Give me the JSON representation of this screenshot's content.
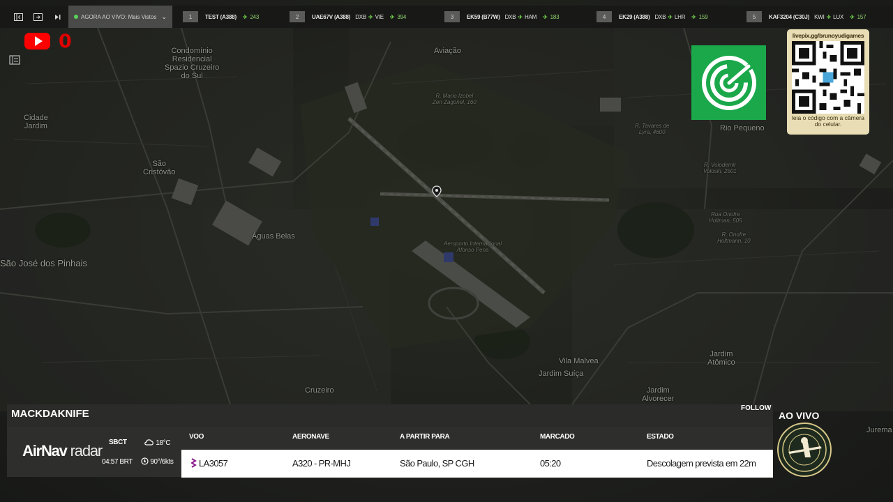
{
  "colors": {
    "live_dot": "#5ad15a",
    "ticker_accent": "#6fce4a",
    "youtube_red": "#ff0000",
    "flightradar_green": "#1aa84a",
    "qr_bg": "#e8ddb4",
    "airline_purple": "#8a1a8c"
  },
  "topbar": {
    "controls": [
      "sidebar-toggle-icon",
      "expand-icon",
      "skip-icon"
    ],
    "live_select": "AGORA AO VIVO: Mais Vistos",
    "flights": [
      {
        "rank": "1",
        "flight": "TEST (A388)",
        "route": "",
        "dest": "",
        "count": "243"
      },
      {
        "rank": "2",
        "flight": "UAE67V (A388)",
        "route": "DXB",
        "dest": "VIE",
        "count": "394"
      },
      {
        "rank": "3",
        "flight": "EK59 (B77W)",
        "route": "DXB",
        "dest": "HAM",
        "count": "183"
      },
      {
        "rank": "4",
        "flight": "EK29 (A388)",
        "route": "DXB",
        "dest": "LHR",
        "count": "159"
      },
      {
        "rank": "5",
        "flight": "KAF3204 (C30J)",
        "route": "KWI",
        "dest": "LUX",
        "count": "157"
      }
    ]
  },
  "overlay": {
    "youtube_count": "0",
    "qr_url": "livepix.gg/brunoyudigames",
    "qr_hint": "leia o código com a câmera do celular."
  },
  "map": {
    "labels": {
      "aviacao": "Aviação",
      "condominio": "Condomínio\nResidencial\nSpazio Cruzeiro\ndo Sul",
      "cidade_jardim": "Cidade\nJardim",
      "sao_cristovao": "São\nCristóvão",
      "sao_jose": "São José dos Pinhais",
      "aguas_belas": "Águas Belas",
      "rio_pequeno": "Rio Pequeno",
      "vila_malvea": "Vila Malvea",
      "jardim_suica": "Jardim Suíça",
      "jardim_alvorecer": "Jardim\nAlvorecer",
      "jardim_atomico": "Jardim\nAtômico",
      "cruzeiro": "Cruzeiro",
      "jurema": "Jurema",
      "aeroporto": "Aeroporto Internacional\nAfonso Pena",
      "r_mario": "R. Mario Izobel\nZen Zagonel, 160",
      "r_tavares": "R. Tavares de\nLyra, 4600",
      "r_volodemir": "R. Volodemir\nVoloski, 2501",
      "rua_onofre": "Rua Onofre\nHoltman, 505",
      "r_onofre": "R. Onofre\nHoltmann, 10"
    }
  },
  "panel": {
    "callsign": "MACKDAKNIFE",
    "follow": "FOLLOW",
    "brand_bold": "AirNav",
    "brand_light": "radar",
    "airport": "SBCT",
    "time": "04:57 BRT",
    "temp": "18°C",
    "wind": "90°/6kts",
    "headers": {
      "flight": "VOO",
      "aircraft": "AERONAVE",
      "route": "A PARTIR PARA",
      "scheduled": "MARCADO",
      "status": "ESTADO"
    },
    "row": {
      "flight": "LA3057",
      "aircraft": "A320 - PR-MHJ",
      "route": "São Paulo, SP CGH",
      "scheduled": "05:20",
      "status": "Descolagem prevista em 22m"
    }
  },
  "badge": {
    "title": "AO VIVO"
  }
}
